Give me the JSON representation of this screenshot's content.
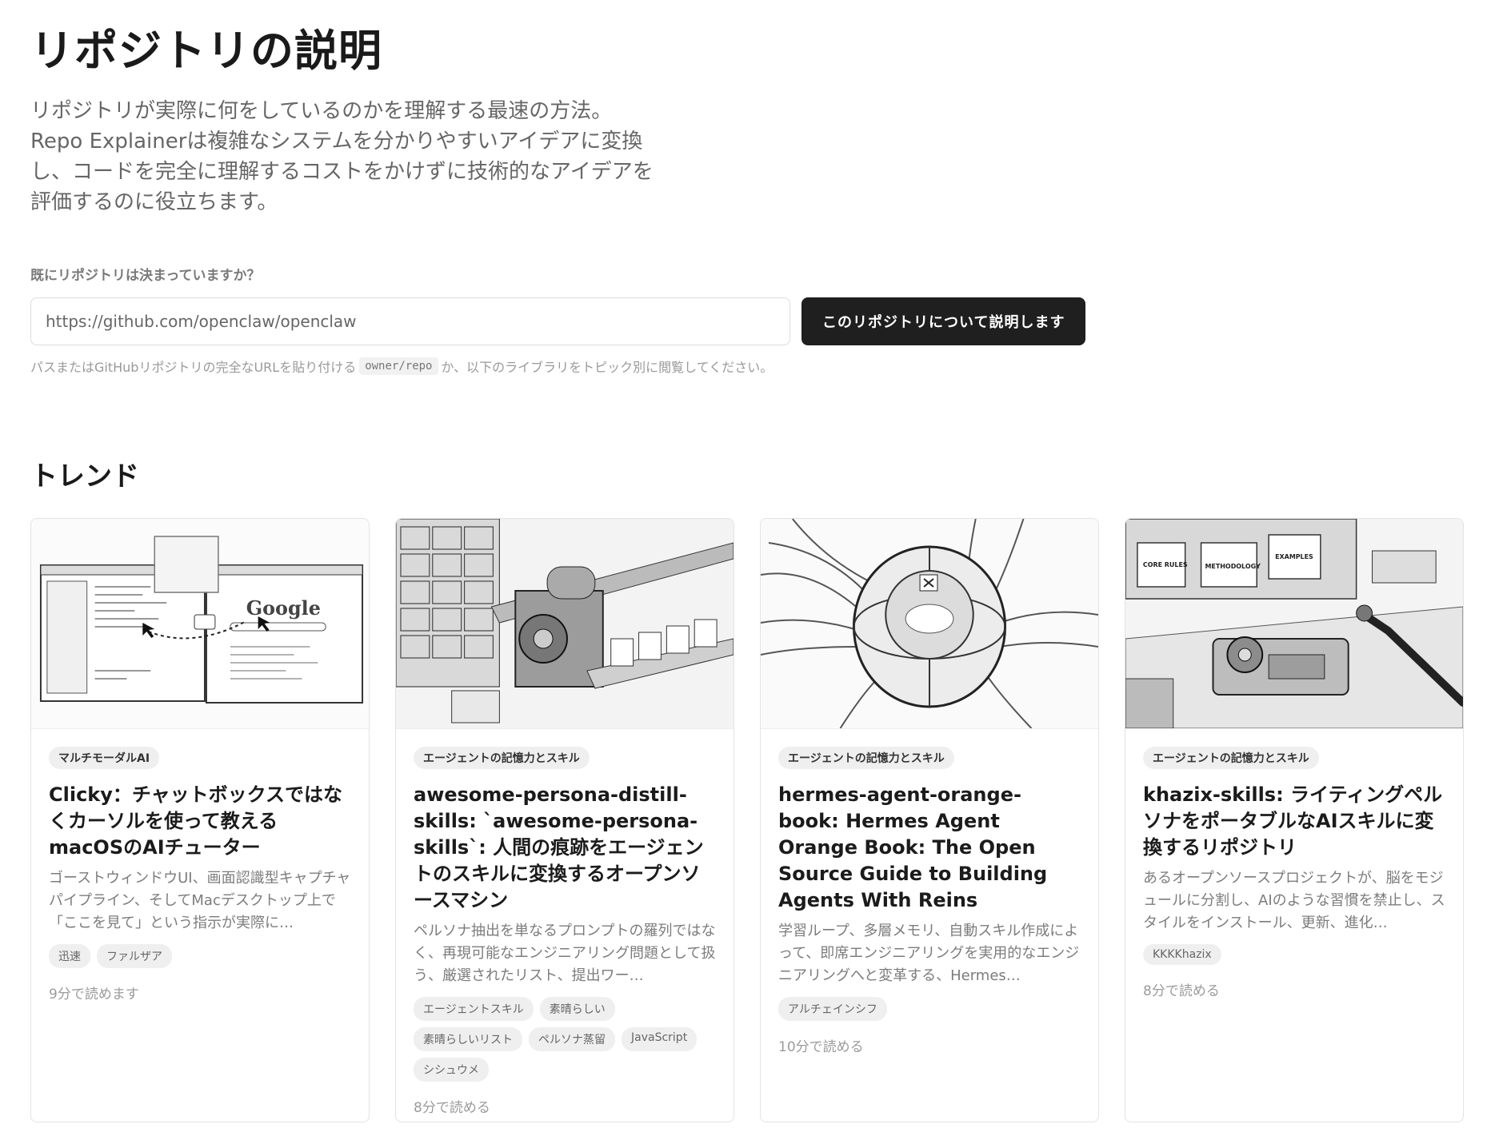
{
  "header": {
    "title": "リポジトリの説明",
    "intro_lines": [
      "リポジトリが実際に何をしているのかを理解する最速の方法。",
      "Repo Explainerは複雑なシステムを分かりやすいアイデアに変換",
      "し、コードを完全に理解するコストをかけずに技術的なアイデアを",
      "評価するのに役立ちます。"
    ]
  },
  "search": {
    "label": "既にリポジトリは決まっていますか？",
    "placeholder": "https://github.com/openclaw/openclaw",
    "button_label": "このリポジトリについて説明します",
    "hint_before": "パスまたはGitHubリポジトリの完全なURLを貼り付ける",
    "hint_code": "owner/repo",
    "hint_after": "か、以下のライブラリをトピック別に閲覧してください。"
  },
  "trending": {
    "title": "トレンド",
    "cards": [
      {
        "category": "マルチモーダルAI",
        "title": "Clicky：チャットボックスではなくカーソルを使って教えるmacOSのAIチューター",
        "description": "ゴーストウィンドウUI、画面認識型キャプチャパイプライン、そしてMacデスクトップ上で「ここを見て」という指示が実際に…",
        "tags": [
          "迅速",
          "ファルザア"
        ],
        "read_time": "9分で読めます",
        "image": "screen-sketch-illustration"
      },
      {
        "category": "エージェントの記憶力とスキル",
        "title": "awesome-persona-distill-skills: `awesome-persona-skills`: 人間の痕跡をエージェントのスキルに変換するオープンソースマシン",
        "description": "ペルソナ抽出を単なるプロンプトの羅列ではなく、再現可能なエンジニアリング問題として扱う、厳選されたリスト、提出ワー…",
        "tags": [
          "エージェントスキル",
          "素晴らしい",
          "素晴らしいリスト",
          "ペルソナ蒸留",
          "JavaScript",
          "シシュウメ"
        ],
        "read_time": "8分で読める",
        "image": "machine-sketch-illustration"
      },
      {
        "category": "エージェントの記憶力とスキル",
        "title": "hermes-agent-orange-book: Hermes Agent Orange Book: The Open Source Guide to Building Agents With Reins",
        "description": "学習ループ、多層メモリ、自動スキル作成によって、即席エンジニアリングを実用的なエンジニアリングへと変革する、Hermes…",
        "tags": [
          "アルチェインシフ"
        ],
        "read_time": "10分で読める",
        "image": "sphere-sketch-illustration"
      },
      {
        "category": "エージェントの記憶力とスキル",
        "title": "khazix-skills: ライティングペルソナをポータブルなAIスキルに変換するリポジトリ",
        "description": "あるオープンソースプロジェクトが、脳をモジュールに分割し、AIのような習慣を禁止し、スタイルをインストール、更新、進化…",
        "tags": [
          "KKKKhazix"
        ],
        "read_time": "8分で読める",
        "image": "robot-sketch-illustration"
      }
    ],
    "thumb_labels": {
      "google": "Google",
      "core_rules": "CORE RULES",
      "methodology": "METHODOLOGY",
      "examples": "EXAMPLES"
    }
  }
}
